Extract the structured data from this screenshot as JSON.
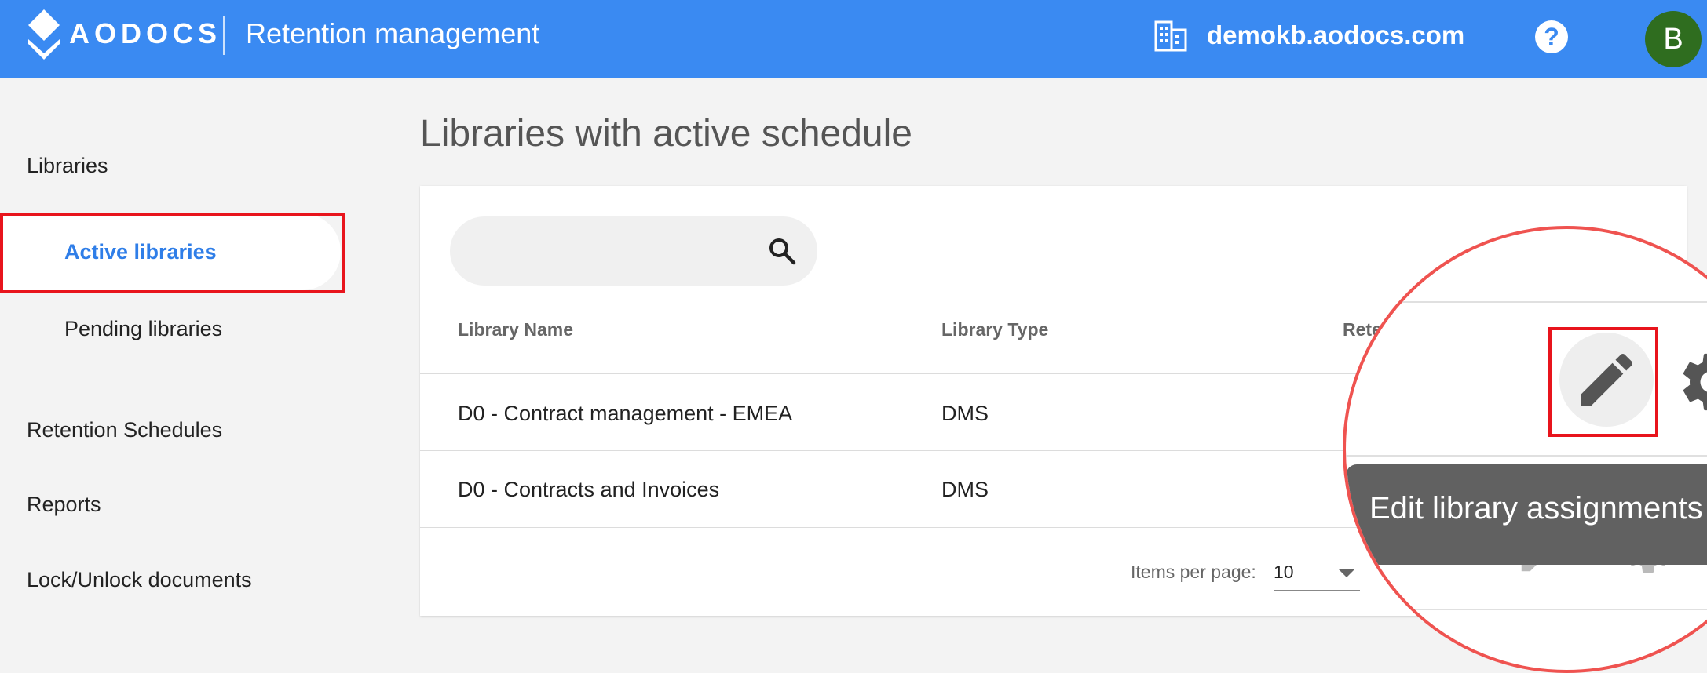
{
  "header": {
    "logo_text": "AODOCS",
    "app_title": "Retention management",
    "domain": "demokb.aodocs.com",
    "help_glyph": "?",
    "avatar_initial": "B",
    "colors": {
      "bar": "#3a8af2",
      "avatar": "#2f6d1f"
    }
  },
  "sidebar": {
    "libraries": "Libraries",
    "active_libraries": "Active libraries",
    "pending_libraries": "Pending libraries",
    "retention_schedules": "Retention Schedules",
    "reports": "Reports",
    "lock_unlock": "Lock/Unlock documents"
  },
  "main": {
    "title": "Libraries with active schedule",
    "table": {
      "headers": [
        "Library Name",
        "Library Type",
        "Rete"
      ],
      "rows": [
        {
          "name": "D0 - Contract management - EMEA",
          "type": "DMS"
        },
        {
          "name": "D0 - Contracts and Invoices",
          "type": "DMS"
        }
      ]
    },
    "pagination": {
      "label": "Items per page:",
      "value": "10"
    }
  },
  "zoom": {
    "tooltip": "Edit library assignments",
    "icons": [
      "pencil-icon",
      "gear-icon"
    ]
  }
}
